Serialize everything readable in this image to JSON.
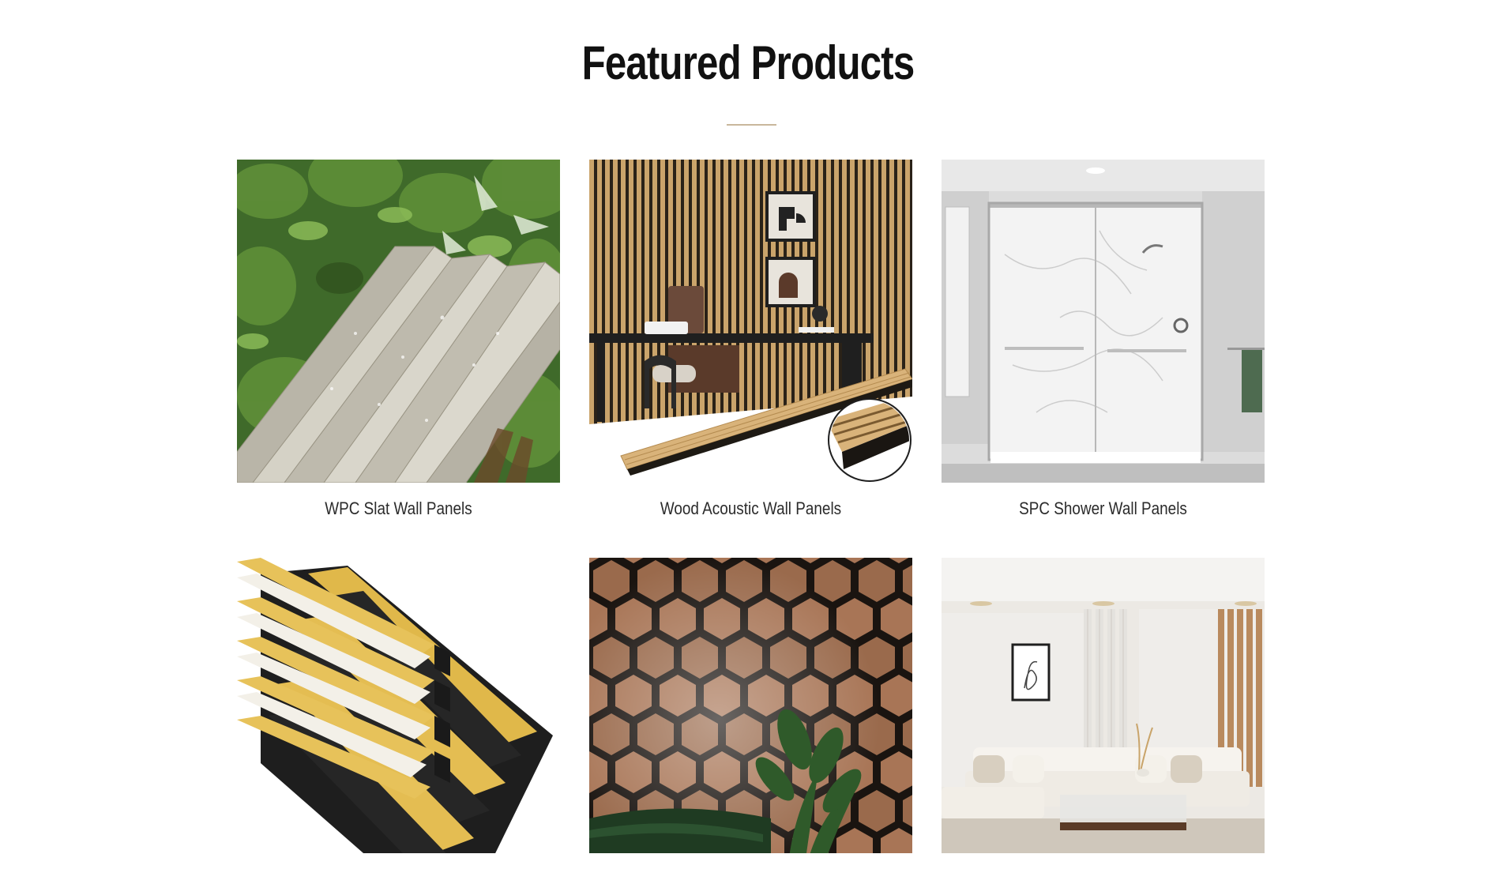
{
  "section": {
    "title": "Featured Products"
  },
  "products": [
    {
      "name": "WPC Slat Wall Panels",
      "image_icon": "wpc-slat-panel-image"
    },
    {
      "name": "Wood Acoustic Wall Panels",
      "image_icon": "wood-acoustic-panel-image"
    },
    {
      "name": "SPC Shower Wall Panels",
      "image_icon": "spc-shower-panel-image"
    },
    {
      "name": "",
      "image_icon": "gold-fluted-panel-image"
    },
    {
      "name": "",
      "image_icon": "hexagon-wood-panel-image"
    },
    {
      "name": "",
      "image_icon": "living-room-panel-image"
    }
  ],
  "colors": {
    "heading": "#111111",
    "divider": "#c9b79c",
    "caption": "#2b2b2b"
  }
}
